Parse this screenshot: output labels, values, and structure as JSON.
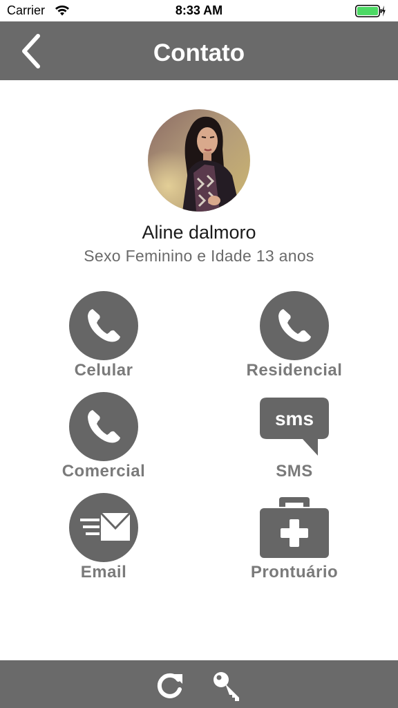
{
  "status_bar": {
    "carrier": "Carrier",
    "time": "8:33 AM",
    "wifi_icon": "wifi-icon",
    "battery_icon": "battery-icon",
    "battery_color": "#4cd964"
  },
  "header": {
    "title": "Contato",
    "back_icon": "chevron-left-icon",
    "background": "#6a6a6a"
  },
  "profile": {
    "name": "Aline dalmoro",
    "subtitle": "Sexo Feminino e Idade 13 anos"
  },
  "actions": {
    "celular": {
      "label": "Celular",
      "icon": "phone-icon"
    },
    "residencial": {
      "label": "Residencial",
      "icon": "phone-icon"
    },
    "comercial": {
      "label": "Comercial",
      "icon": "phone-icon"
    },
    "sms": {
      "label": "SMS",
      "icon": "sms-bubble-icon",
      "icon_text": "sms"
    },
    "email": {
      "label": "Email",
      "icon": "envelope-icon"
    },
    "prontuario": {
      "label": "Prontuário",
      "icon": "medical-kit-icon"
    }
  },
  "bottom_bar": {
    "refresh_icon": "refresh-icon",
    "key_icon": "key-icon"
  },
  "colors": {
    "icon_gray": "#666666",
    "label_gray": "#7a7a7a"
  }
}
